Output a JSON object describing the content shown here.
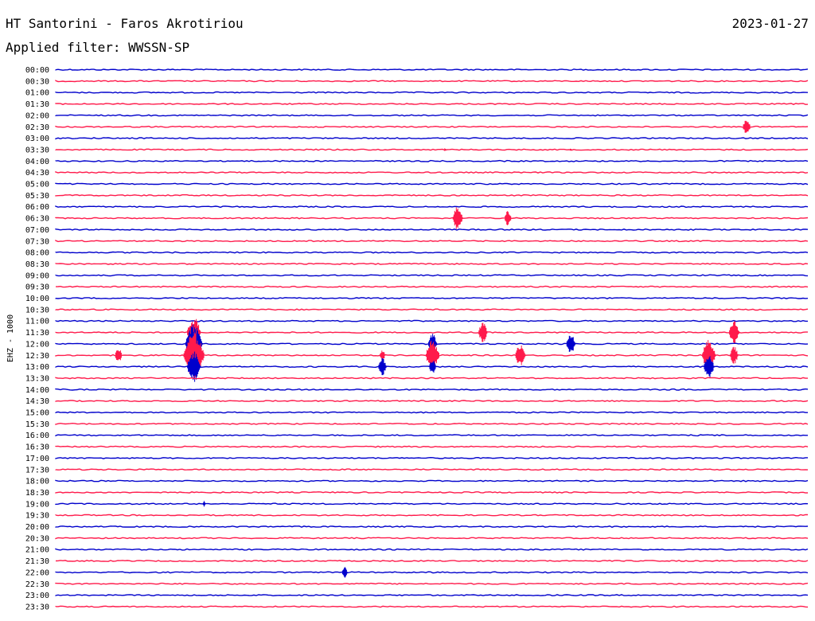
{
  "header": {
    "station": "HT Santorini - Faros Akrotiriou",
    "date": "2023-01-27",
    "filter_text": "Applied filter: WWSSN-SP"
  },
  "chart_data": {
    "type": "line",
    "title": "HT Santorini - Faros Akrotiriou",
    "ylabel": "EHZ - 1000",
    "filter": "WWSSN-SP",
    "row_labels": [
      "00:00",
      "00:30",
      "01:00",
      "01:30",
      "02:00",
      "02:30",
      "03:00",
      "03:30",
      "04:00",
      "04:30",
      "05:00",
      "05:30",
      "06:00",
      "06:30",
      "07:00",
      "07:30",
      "08:00",
      "08:30",
      "09:00",
      "09:30",
      "10:00",
      "10:30",
      "11:00",
      "11:30",
      "12:00",
      "12:30",
      "13:00",
      "13:30",
      "14:00",
      "14:30",
      "15:00",
      "15:30",
      "16:00",
      "16:30",
      "17:00",
      "17:30",
      "18:00",
      "18:30",
      "19:00",
      "19:30",
      "20:00",
      "20:30",
      "21:00",
      "21:30",
      "22:00",
      "22:30",
      "23:00",
      "23:30"
    ],
    "trace_colors": [
      "#0000cc",
      "#ff1a4b"
    ],
    "row_minutes": 30,
    "events": [
      {
        "row": "02:30",
        "minute": 27.5,
        "amplitude": 11
      },
      {
        "row": "03:30",
        "minute": 15.5,
        "amplitude": 2
      },
      {
        "row": "03:30",
        "minute": 20.5,
        "amplitude": 2
      },
      {
        "row": "06:30",
        "minute": 16.0,
        "amplitude": 15
      },
      {
        "row": "06:30",
        "minute": 18.0,
        "amplitude": 10
      },
      {
        "row": "11:30",
        "minute": 5.5,
        "amplitude": 20
      },
      {
        "row": "11:30",
        "minute": 17.0,
        "amplitude": 13
      },
      {
        "row": "11:30",
        "minute": 27.0,
        "amplitude": 15
      },
      {
        "row": "12:00",
        "minute": 5.5,
        "amplitude": 25
      },
      {
        "row": "12:00",
        "minute": 15.0,
        "amplitude": 13
      },
      {
        "row": "12:00",
        "minute": 20.5,
        "amplitude": 13
      },
      {
        "row": "12:30",
        "minute": 2.5,
        "amplitude": 10
      },
      {
        "row": "12:30",
        "minute": 5.5,
        "amplitude": 30
      },
      {
        "row": "12:30",
        "minute": 13.0,
        "amplitude": 8
      },
      {
        "row": "12:30",
        "minute": 15.0,
        "amplitude": 20
      },
      {
        "row": "12:30",
        "minute": 18.5,
        "amplitude": 15
      },
      {
        "row": "12:30",
        "minute": 26.0,
        "amplitude": 20
      },
      {
        "row": "12:30",
        "minute": 27.0,
        "amplitude": 12
      },
      {
        "row": "13:00",
        "minute": 5.5,
        "amplitude": 20
      },
      {
        "row": "13:00",
        "minute": 13.0,
        "amplitude": 12
      },
      {
        "row": "13:00",
        "minute": 15.0,
        "amplitude": 10
      },
      {
        "row": "13:00",
        "minute": 26.0,
        "amplitude": 15
      },
      {
        "row": "19:00",
        "minute": 5.9,
        "amplitude": 4
      },
      {
        "row": "22:00",
        "minute": 11.5,
        "amplitude": 8
      }
    ]
  }
}
